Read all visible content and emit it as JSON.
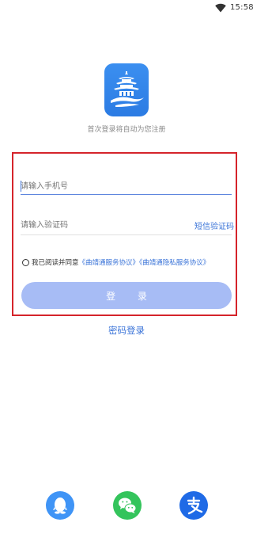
{
  "status_bar": {
    "time": "15:58",
    "wifi_icon": "wifi-icon"
  },
  "logo": {
    "icon": "pagoda-logo-icon",
    "color": "#2b7be3"
  },
  "hint": "首次登录将自动为您注册",
  "form": {
    "phone_placeholder": "请输入手机号",
    "phone_value": "",
    "code_placeholder": "请输入验证码",
    "code_value": "",
    "sms_button": "短信验证码",
    "agree_prefix": "我已阅读并同意",
    "service_agreement": "《曲靖通服务协议》",
    "privacy_agreement": "《曲靖通隐私服务协议》",
    "agree_checked": false,
    "login_button": "登 录"
  },
  "password_login": "密码登录",
  "social": {
    "qq_icon": "qq-icon",
    "wechat_icon": "wechat-icon",
    "alipay_icon": "alipay-icon"
  },
  "colors": {
    "accent": "#3b74d8",
    "login_button_bg": "#a7bcf5",
    "highlight_border": "#d5242b",
    "qq": "#3f94f6",
    "wechat": "#34c45c",
    "alipay": "#1f6ae6"
  }
}
